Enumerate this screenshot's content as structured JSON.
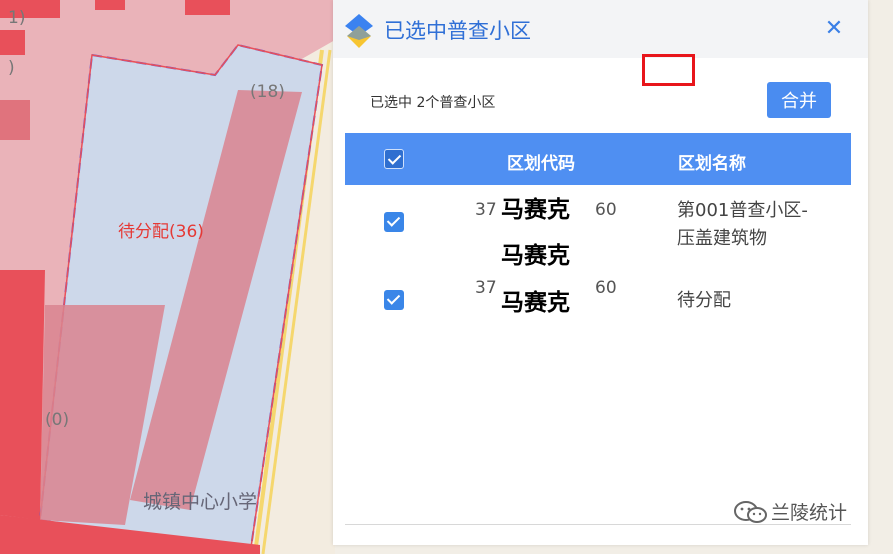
{
  "map": {
    "labels": {
      "l1": "1)",
      "l2": ")",
      "l18": "(18)",
      "pending": "待分配(36)",
      "l0": "(0)",
      "school": "城镇中心小学"
    }
  },
  "panel": {
    "title": "已选中普查小区",
    "close_icon": "✕",
    "selected_info": "已选中 2个普查小区",
    "merge_label": "合并",
    "table": {
      "columns": [
        "区划代码",
        "区划名称"
      ],
      "rows": [
        {
          "checked": true,
          "code_prefix": "37",
          "code_suffix": "60",
          "code_mask": "马赛克",
          "name_line1": "第001普查小区-",
          "name_line2": "压盖建筑物"
        },
        {
          "checked": true,
          "code_prefix": "37",
          "code_suffix": "60",
          "code_mask": "马赛克",
          "name_line1": "待分配",
          "name_line2": ""
        }
      ],
      "mosaic_middle": "马赛克"
    }
  },
  "watermark": {
    "icon": "wechat-icon",
    "text": "兰陵统计"
  },
  "colors": {
    "accent": "#4f8ff2",
    "title": "#2f6fd6",
    "map_red": "#e8505a",
    "map_pink": "#e9a4ad",
    "highlight_box": "#e8151b"
  }
}
